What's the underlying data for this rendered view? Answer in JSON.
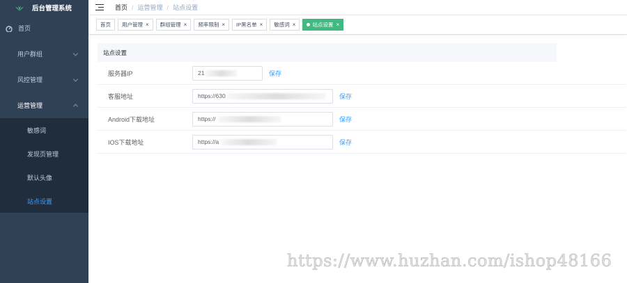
{
  "app": {
    "title": "后台管理系统"
  },
  "sidebar": {
    "home": "首页",
    "groups": [
      {
        "label": "用户群组"
      },
      {
        "label": "风控管理"
      },
      {
        "label": "运营管理"
      }
    ],
    "subitems": [
      {
        "label": "敏感词"
      },
      {
        "label": "发现页管理"
      },
      {
        "label": "默认头像"
      },
      {
        "label": "站点设置"
      }
    ]
  },
  "breadcrumb": [
    "首页",
    "运营管理",
    "站点设置"
  ],
  "tags": [
    {
      "label": "首页"
    },
    {
      "label": "用户管理"
    },
    {
      "label": "群组管理"
    },
    {
      "label": "频率限制"
    },
    {
      "label": "IP黑名单"
    },
    {
      "label": "敏感词"
    },
    {
      "label": "站点设置"
    }
  ],
  "settings": {
    "header": "站点设置",
    "rows": [
      {
        "label": "服务器IP",
        "value": "21",
        "save": "保存"
      },
      {
        "label": "客服地址",
        "value": "https://630",
        "save": "保存"
      },
      {
        "label": "Android下载地址",
        "value": "https://",
        "save": "保存"
      },
      {
        "label": "IOS下载地址",
        "value": "https://a",
        "save": "保存"
      }
    ]
  },
  "watermark": "https://www.huzhan.com/ishop48166",
  "colors": {
    "sidebar": "#304156",
    "submenu": "#1f2d3d",
    "active": "#409eff",
    "tag_active": "#42b983"
  }
}
